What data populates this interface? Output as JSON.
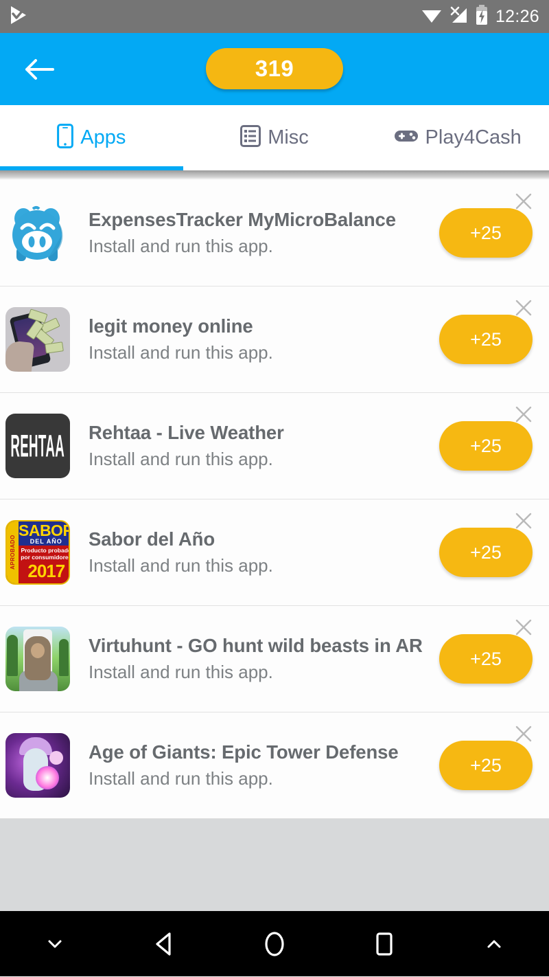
{
  "statusbar": {
    "notification_icon": "play-check-icon",
    "wifi_icon": "wifi-icon",
    "signal_icon": "signal-no-service-icon",
    "battery_icon": "battery-charging-icon",
    "time": "12:26"
  },
  "appbar": {
    "back_icon": "back-arrow-icon",
    "coin_balance": "319"
  },
  "tabs": [
    {
      "label": "Apps",
      "icon": "phone-icon",
      "active": true
    },
    {
      "label": "Misc",
      "icon": "list-document-icon",
      "active": false
    },
    {
      "label": "Play4Cash",
      "icon": "gamepad-icon",
      "active": false
    }
  ],
  "offers": [
    {
      "title": "ExpensesTracker MyMicroBalance",
      "subtitle": "Install and run this app.",
      "reward": "+25",
      "icon": "piggy-bank-icon",
      "close_icon": "close-icon"
    },
    {
      "title": "legit money online",
      "subtitle": "Install and run this app.",
      "reward": "+25",
      "icon": "money-phone-icon",
      "close_icon": "close-icon"
    },
    {
      "title": "Rehtaa - Live Weather",
      "subtitle": "Install and run this app.",
      "reward": "+25",
      "icon": "rehtaa-logo-icon",
      "icon_text": "REHTAA",
      "close_icon": "close-icon"
    },
    {
      "title": "Sabor del Año",
      "subtitle": "Install and run this app.",
      "reward": "+25",
      "icon": "sabor-del-ano-icon",
      "close_icon": "close-icon",
      "icon_text": {
        "aprobado": "APROBADO",
        "sabor": "SABOR",
        "del_ano": "DEL AÑO",
        "claim": "Producto probado por consumidores",
        "year": "2017"
      }
    },
    {
      "title": "Virtuhunt - GO hunt wild beasts in AR",
      "subtitle": "Install and run this app.",
      "reward": "+25",
      "icon": "virtuhunt-icon",
      "close_icon": "close-icon"
    },
    {
      "title": "Age of Giants: Epic Tower Defense",
      "subtitle": "Install and run this app.",
      "reward": "+25",
      "icon": "age-of-giants-icon",
      "close_icon": "close-icon"
    }
  ],
  "navbar": [
    {
      "icon": "chevron-down-icon"
    },
    {
      "icon": "back-triangle-icon"
    },
    {
      "icon": "home-circle-icon"
    },
    {
      "icon": "recents-square-icon"
    },
    {
      "icon": "chevron-up-icon"
    }
  ],
  "colors": {
    "accent_blue": "#03a9f4",
    "reward_yellow": "#f5b712",
    "statusbar_gray": "#757575",
    "filler_gray": "#d7d9da",
    "text_gray": "#666a6e"
  }
}
